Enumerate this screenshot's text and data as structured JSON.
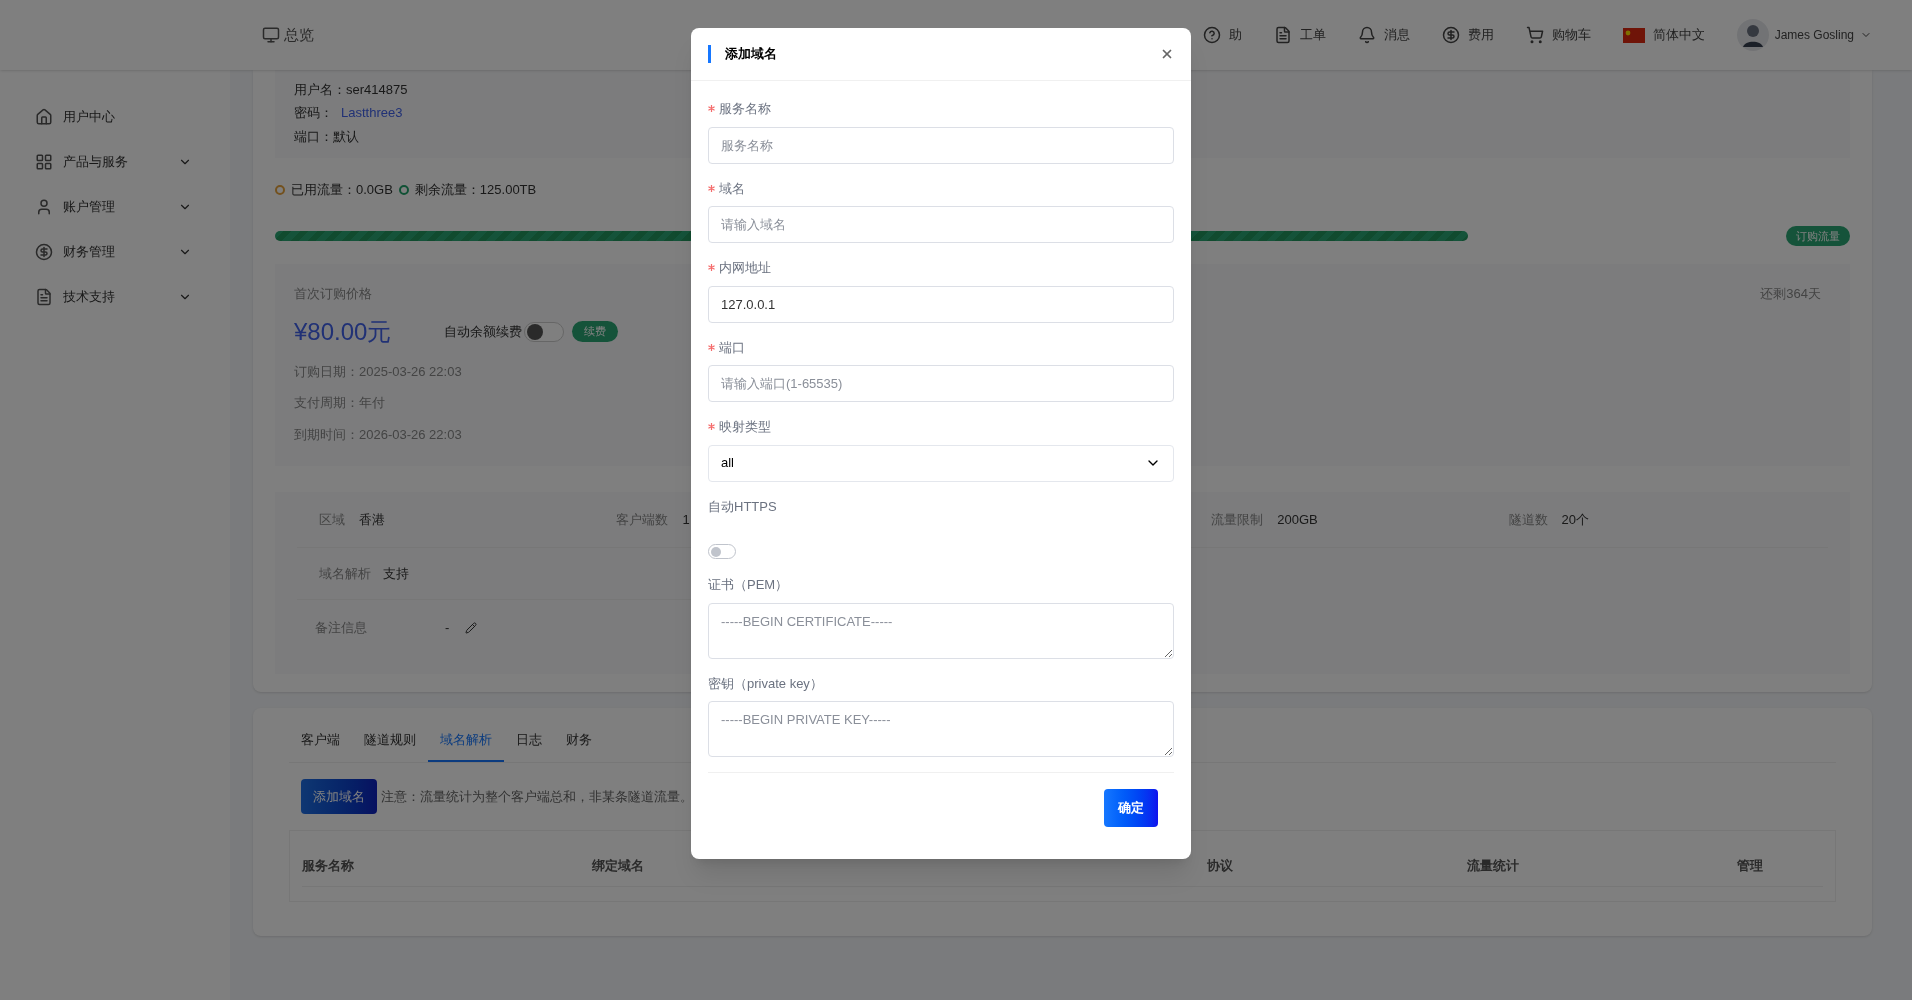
{
  "header": {
    "home_label": "总览",
    "nav": [
      {
        "kind": "help",
        "label": "助"
      },
      {
        "kind": "ticket",
        "label": "工单"
      },
      {
        "kind": "bell",
        "label": "消息"
      },
      {
        "kind": "fee",
        "label": "费用"
      },
      {
        "kind": "cart",
        "label": "购物车"
      }
    ],
    "language": "简体中文",
    "user": "James Gosling"
  },
  "sidebar": {
    "items": [
      {
        "kind": "home",
        "label": "用户中心",
        "expandable": false
      },
      {
        "kind": "grid",
        "label": "产品与服务",
        "expandable": true
      },
      {
        "kind": "user",
        "label": "账户管理",
        "expandable": true
      },
      {
        "kind": "fee",
        "label": "财务管理",
        "expandable": true
      },
      {
        "kind": "doc",
        "label": "技术支持",
        "expandable": true
      }
    ]
  },
  "login_info": [
    {
      "label": "用户名：",
      "value": "ser414875",
      "link": false
    },
    {
      "label": "密码：",
      "value": "Lastthree3",
      "link": true
    },
    {
      "label": "端口：",
      "value": "默认",
      "link": false
    }
  ],
  "traffic": {
    "used": "已用流量：0.0GB",
    "remaining": "剩余流量：125.00TB",
    "level": 0.8,
    "buy_button": "订购流量"
  },
  "price": {
    "label": "首次订购价格",
    "amount": "¥80.00元",
    "auto_renew": {
      "label": "自动余额续费",
      "on": false
    },
    "renew_button": "续费",
    "remaining_days": "还剩364天",
    "dates": [
      "订购日期：2025-03-26 22:03",
      "支付周期：年付",
      "到期时间：2026-03-26 22:03"
    ]
  },
  "details": {
    "row_1": [
      {
        "label": "区域",
        "value": "香港"
      },
      {
        "label": "客户端数",
        "value": "1"
      },
      {
        "label": "流量限制",
        "value": "200GB"
      },
      {
        "label": "隧道数",
        "value": "20个"
      }
    ],
    "dns": {
      "label": "域名解析",
      "value": "支持"
    },
    "note": {
      "label": "备注信息",
      "value": "-"
    }
  },
  "tabs": [
    {
      "label": "客户端",
      "selected": false
    },
    {
      "label": "隧道规则",
      "selected": false
    },
    {
      "label": "域名解析",
      "selected": true
    },
    {
      "label": "日志",
      "selected": false
    },
    {
      "label": "财务",
      "selected": false
    }
  ],
  "add_button": "添加域名",
  "notice": "注意：流量统计为整个客户端总和，非某条隧道流量。",
  "table": {
    "columns": [
      "服务名称",
      "绑定域名",
      "协议",
      "流量统计",
      "管理"
    ]
  },
  "modal": {
    "title": "添加域名",
    "fields": [
      {
        "kind": "input",
        "label": "服务名称",
        "required": true,
        "placeholder": "服务名称"
      },
      {
        "kind": "input",
        "label": "域名",
        "required": true,
        "placeholder": "请输入域名"
      },
      {
        "kind": "input",
        "label": "内网地址",
        "required": true,
        "value": "127.0.0.1"
      },
      {
        "kind": "input",
        "label": "端口",
        "required": true,
        "placeholder": "请输入端口(1-65535)"
      },
      {
        "kind": "select",
        "label": "映射类型",
        "required": true,
        "value": "all"
      },
      {
        "kind": "toggle",
        "label": "自动HTTPS",
        "required": false,
        "on": false
      },
      {
        "kind": "textarea",
        "label": "证书（PEM）",
        "required": false,
        "placeholder": "-----BEGIN CERTIFICATE-----"
      },
      {
        "kind": "textarea",
        "label": "密钥（private key）",
        "required": false,
        "placeholder": "-----BEGIN PRIVATE KEY-----"
      }
    ],
    "confirm_button": "确定"
  }
}
